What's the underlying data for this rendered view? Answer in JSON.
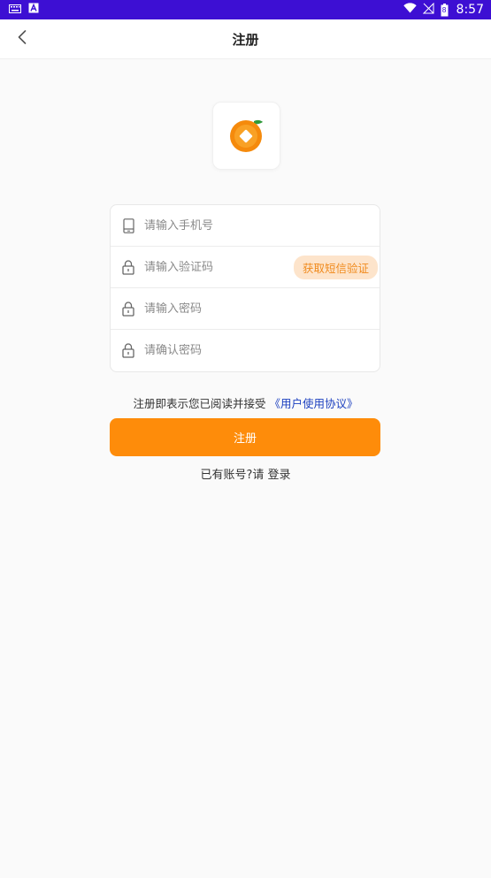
{
  "status_bar": {
    "time": "8:57",
    "battery_level": "8"
  },
  "header": {
    "title": "注册"
  },
  "form": {
    "phone_placeholder": "请输入手机号",
    "code_placeholder": "请输入验证码",
    "sms_button_label": "获取短信验证",
    "password_placeholder": "请输入密码",
    "confirm_placeholder": "请确认密码"
  },
  "agreement": {
    "prefix": "注册即表示您已阅读并接受",
    "link_label": "《用户使用协议》"
  },
  "register_button_label": "注册",
  "login": {
    "prefix": "已有账号?请",
    "link_label": "登录"
  },
  "colors": {
    "status_bar": "#3d0fd3",
    "accent_orange": "#fe8c0a",
    "link_blue": "#1b3fbf",
    "sms_pill_bg": "#fde4cb"
  }
}
